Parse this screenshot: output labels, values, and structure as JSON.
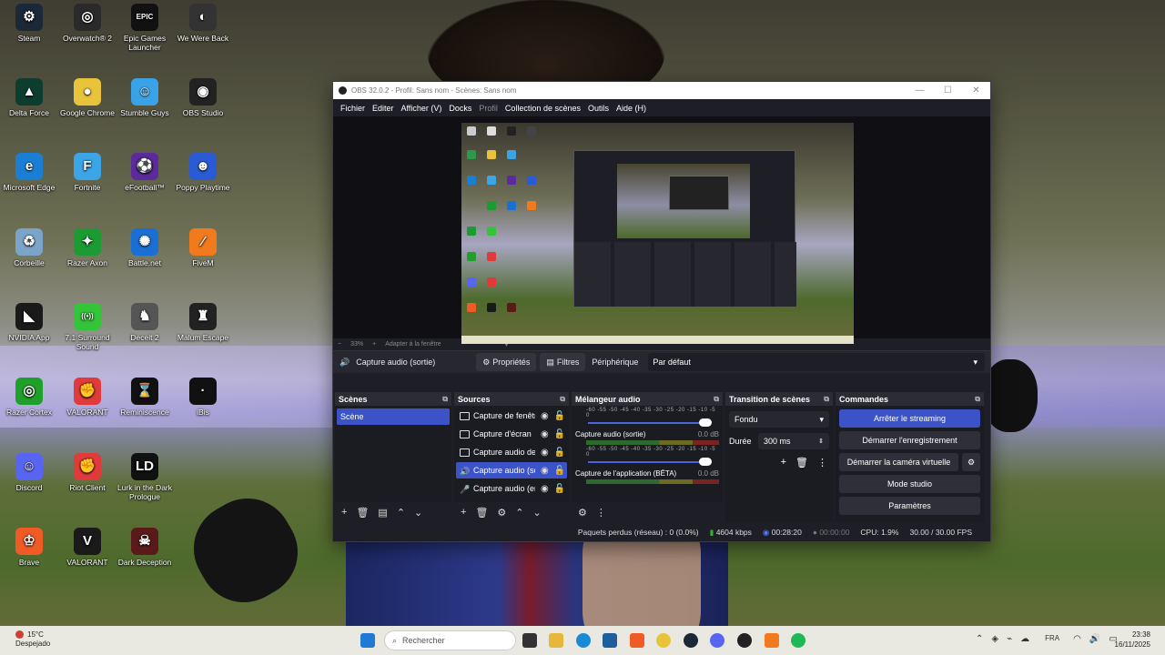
{
  "desktop": {
    "icons": [
      {
        "label": "Steam",
        "glyph": "⚙",
        "bg": "#1b2838"
      },
      {
        "label": "Overwatch® 2",
        "glyph": "◎",
        "bg": "#2a2a2a"
      },
      {
        "label": "Epic Games Launcher",
        "glyph": "EPIC",
        "bg": "#111"
      },
      {
        "label": "We Were Back",
        "glyph": "◐",
        "bg": "#333"
      },
      {
        "label": "Delta Force",
        "glyph": "▲",
        "bg": "#0c3d2e"
      },
      {
        "label": "Google Chrome",
        "glyph": "●",
        "bg": "#e9c33a"
      },
      {
        "label": "Stumble Guys",
        "glyph": "☺",
        "bg": "#3aa3e8"
      },
      {
        "label": "OBS Studio",
        "glyph": "◉",
        "bg": "#222"
      },
      {
        "label": "Microsoft Edge",
        "glyph": "e",
        "bg": "#1a7fd4"
      },
      {
        "label": "Fortnite",
        "glyph": "F",
        "bg": "#3ba5e8"
      },
      {
        "label": "eFootball™",
        "glyph": "⚽",
        "bg": "#5c2a9c"
      },
      {
        "label": "Poppy Playtime",
        "glyph": "☻",
        "bg": "#2a5ad4"
      },
      {
        "label": "Corbeille",
        "glyph": "♻",
        "bg": "#7aa4c8"
      },
      {
        "label": "Razer Axon",
        "glyph": "✦",
        "bg": "#1b9b32"
      },
      {
        "label": "Battle.net",
        "glyph": "✺",
        "bg": "#1a6fd4"
      },
      {
        "label": "FiveM",
        "glyph": "⁄",
        "bg": "#f07a1c"
      },
      {
        "label": "NVIDIA App",
        "glyph": "◣",
        "bg": "#1a1a1a"
      },
      {
        "label": "7.1 Surround Sound",
        "glyph": "((•))",
        "bg": "#33c43a"
      },
      {
        "label": "Deceit 2",
        "glyph": "♞",
        "bg": "#555"
      },
      {
        "label": "Malum Escape",
        "glyph": "♜",
        "bg": "#222"
      },
      {
        "label": "Razer Cortex",
        "glyph": "◎",
        "bg": "#1fa02a"
      },
      {
        "label": "VALORANT",
        "glyph": "✊",
        "bg": "#e03a3a"
      },
      {
        "label": "Reminiscence",
        "glyph": "⌛",
        "bg": "#111"
      },
      {
        "label": "iBis",
        "glyph": "·",
        "bg": "#111"
      },
      {
        "label": "Discord",
        "glyph": "☺",
        "bg": "#5865f2"
      },
      {
        "label": "Riot Client",
        "glyph": "✊",
        "bg": "#e03a3a"
      },
      {
        "label": "Lurk in the Dark Prologue",
        "glyph": "LD",
        "bg": "#111"
      },
      {
        "label": "",
        "glyph": "",
        "bg": "transparent"
      },
      {
        "label": "Brave",
        "glyph": "♔",
        "bg": "#f05a24"
      },
      {
        "label": "VALORANT",
        "glyph": "V",
        "bg": "#1a1a1a"
      },
      {
        "label": "Dark Deception",
        "glyph": "☠",
        "bg": "#5a1a1a"
      }
    ]
  },
  "obs": {
    "title": "OBS 32.0.2 - Profil: Sans nom - Scènes: Sans nom",
    "menu": [
      "Fichier",
      "Editer",
      "Afficher (V)",
      "Docks",
      "Profil",
      "Collection de scènes",
      "Outils",
      "Aide (H)"
    ],
    "zoom": "33%",
    "fit_label": "Adapter à la fenêtre",
    "source_toolbar": {
      "source_name": "Capture audio (sortie)",
      "properties": "Propriétés",
      "filters": "Filtres",
      "device_label": "Périphérique",
      "device_value": "Par défaut"
    },
    "scenes": {
      "title": "Scènes",
      "items": [
        "Scène"
      ]
    },
    "sources": {
      "title": "Sources",
      "items": [
        "Capture de fenêtre",
        "Capture d'écran",
        "Capture audio de",
        "Capture audio (sortie)",
        "Capture audio (entrée)"
      ]
    },
    "mixer": {
      "title": "Mélangeur audio",
      "ticks": "-60 -55 -50 -45 -40 -35 -30 -25 -20 -15 -10 -5 0",
      "channels": [
        {
          "name": "",
          "db": ""
        },
        {
          "name": "Capture audio (sortie)",
          "db": "0.0 dB"
        },
        {
          "name": "Capture de l'application (BÊTA)",
          "db": "0.0 dB"
        }
      ]
    },
    "transitions": {
      "title": "Transition de scènes",
      "selected": "Fondu",
      "duration_label": "Durée",
      "duration_value": "300 ms"
    },
    "controls": {
      "title": "Commandes",
      "buttons": [
        "Arrêter le streaming",
        "Démarrer l'enregistrement",
        "Démarrer la caméra virtuelle",
        "Mode studio",
        "Paramètres"
      ]
    },
    "status": {
      "dropped": "Paquets perdus (réseau) : 0 (0.0%)",
      "bitrate": "4604 kbps",
      "stream_time": "00:28:20",
      "rec_time": "00:00:00",
      "cpu": "CPU: 1.9%",
      "fps": "30.00 / 30.00 FPS"
    }
  },
  "taskbar": {
    "weather_temp": "15°C",
    "weather_desc": "Despejado",
    "search_placeholder": "Rechercher",
    "lang": "FRA",
    "time": "23:38",
    "date": "16/11/2025"
  },
  "colors": {
    "accent": "#3c53c8",
    "obs_bg": "#1e1f26",
    "taskbar": "#e9e9e2"
  }
}
